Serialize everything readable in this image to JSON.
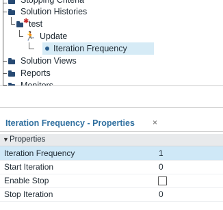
{
  "tree": {
    "items": [
      {
        "label": "Stopping Criteria"
      },
      {
        "label": "Solution Histories"
      },
      {
        "label": "test"
      },
      {
        "label": "Update"
      },
      {
        "label": "Iteration Frequency"
      },
      {
        "label": "Solution Views"
      },
      {
        "label": "Reports"
      },
      {
        "label": "Monitors"
      }
    ]
  },
  "properties_panel": {
    "title": "Iteration Frequency - Properties",
    "close_glyph": "×",
    "section_label": "Properties",
    "rows": [
      {
        "name": "Iteration Frequency",
        "value": "1"
      },
      {
        "name": "Start Iteration",
        "value": "0"
      },
      {
        "name": "Enable Stop",
        "checked": false
      },
      {
        "name": "Stop Iteration",
        "value": "0"
      }
    ]
  }
}
